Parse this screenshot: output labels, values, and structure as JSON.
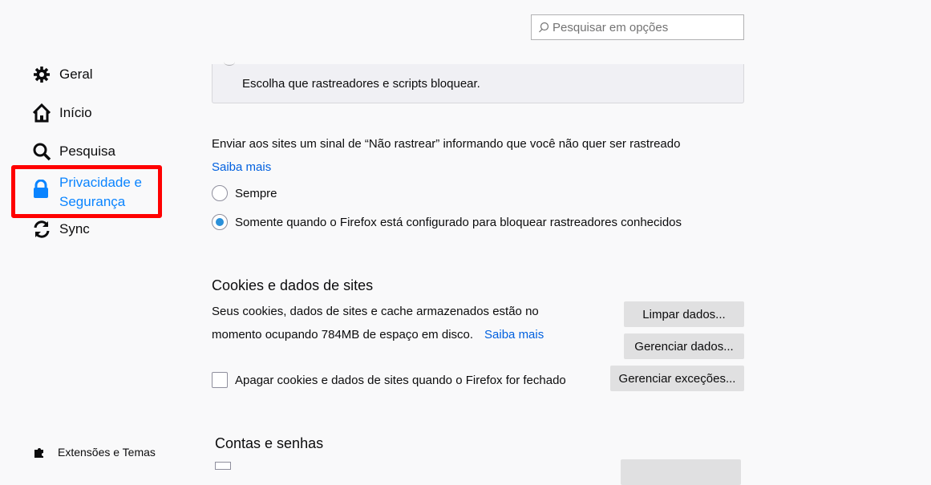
{
  "search": {
    "placeholder": "Pesquisar em opções"
  },
  "sidebar": {
    "items": [
      {
        "label": "Geral"
      },
      {
        "label": "Início"
      },
      {
        "label": "Pesquisa"
      },
      {
        "label": "Privacidade e Segurança",
        "line1": "Privacidade e",
        "line2": "Segurança"
      },
      {
        "label": "Sync"
      }
    ],
    "footer": "Extensões e Temas"
  },
  "tracking": {
    "custom_desc": "Escolha que rastreadores e scripts bloquear."
  },
  "dnt": {
    "text": "Enviar aos sites um sinal de “Não rastrear” informando que você não quer ser rastreado",
    "learn_more": "Saiba mais",
    "options": [
      {
        "label": "Sempre",
        "selected": false
      },
      {
        "label": "Somente quando o Firefox está configurado para bloquear rastreadores conhecidos",
        "selected": true
      }
    ]
  },
  "cookies": {
    "title": "Cookies e dados de sites",
    "desc1": "Seus cookies, dados de sites e cache armazenados estão no",
    "desc2": "momento ocupando 784MB de espaço em disco.",
    "learn_more": "Saiba mais",
    "clear_btn": "Limpar dados...",
    "manage_btn": "Gerenciar dados...",
    "exceptions_btn": "Gerenciar exceções...",
    "delete_on_close": "Apagar cookies e dados de sites quando o Firefox for fechado",
    "delete_checked": false
  },
  "accounts": {
    "title": "Contas e senhas"
  }
}
